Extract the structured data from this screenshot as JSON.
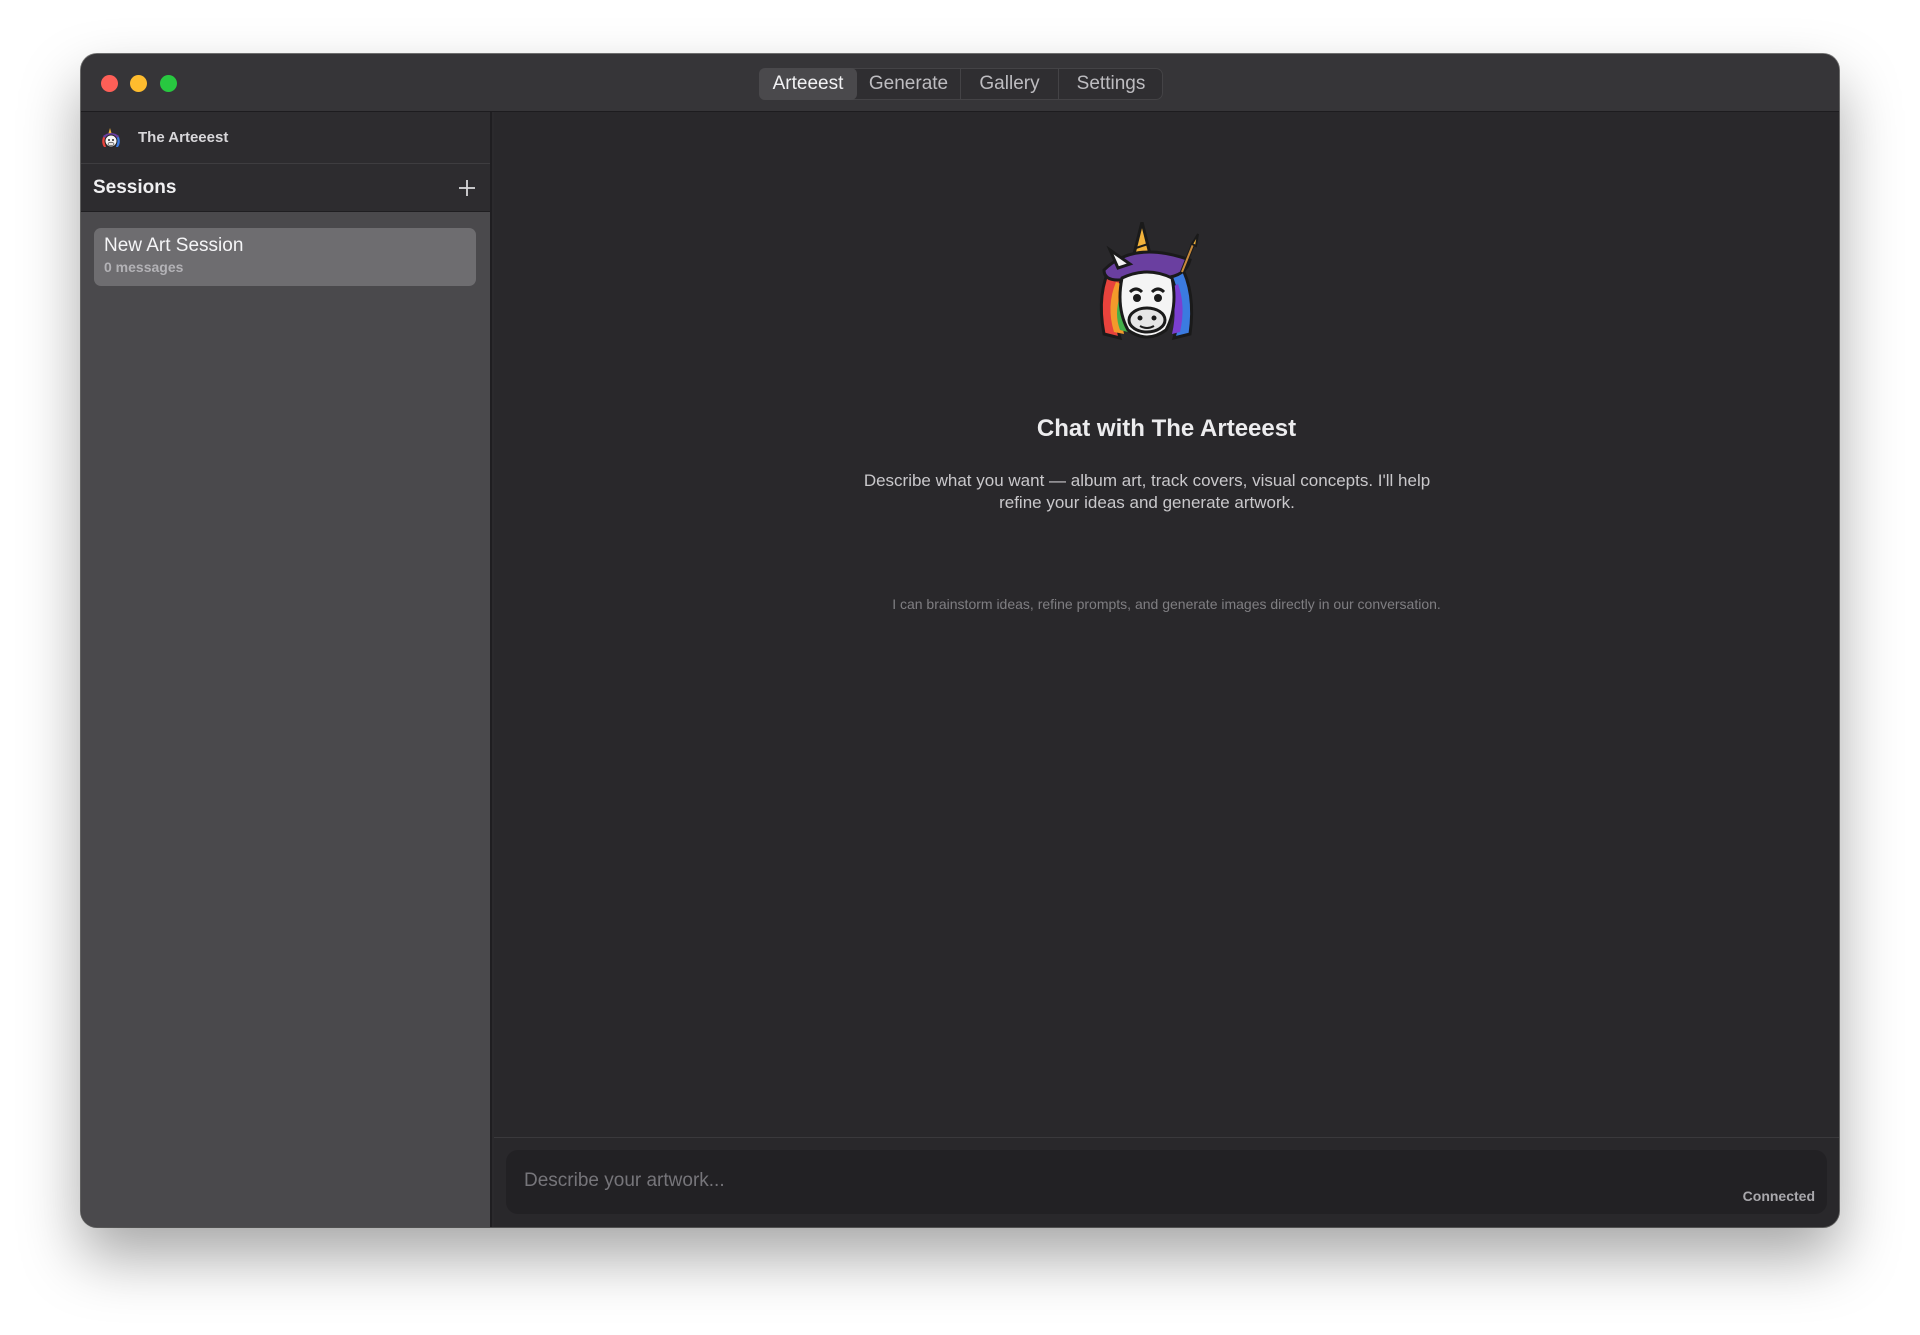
{
  "titlebar": {
    "tabs": [
      {
        "label": "Arteeest",
        "active": true
      },
      {
        "label": "Generate",
        "active": false
      },
      {
        "label": "Gallery",
        "active": false
      },
      {
        "label": "Settings",
        "active": false
      }
    ]
  },
  "sidebar": {
    "app_name": "The Arteeest",
    "app_icon": "unicorn-mascot-icon",
    "sessions_title": "Sessions",
    "add_icon": "plus-icon",
    "sessions": [
      {
        "name": "New Art Session",
        "meta": "0 messages"
      }
    ]
  },
  "main": {
    "title": "Chat with The Arteeest",
    "description": "Describe what you want — album art, track covers, visual concepts. I'll help refine your ideas and generate artwork.",
    "hint": "I can brainstorm ideas, refine prompts, and generate images directly in our conversation."
  },
  "composer": {
    "placeholder": "Describe your artwork...",
    "status": "Connected"
  },
  "colors": {
    "window_bg": "#2b2a2d",
    "sidebar_bg": "#4a494c",
    "selected_session": "#6e6d70",
    "close": "#fe5f57",
    "minimize": "#febc2e",
    "zoom": "#28c840"
  }
}
